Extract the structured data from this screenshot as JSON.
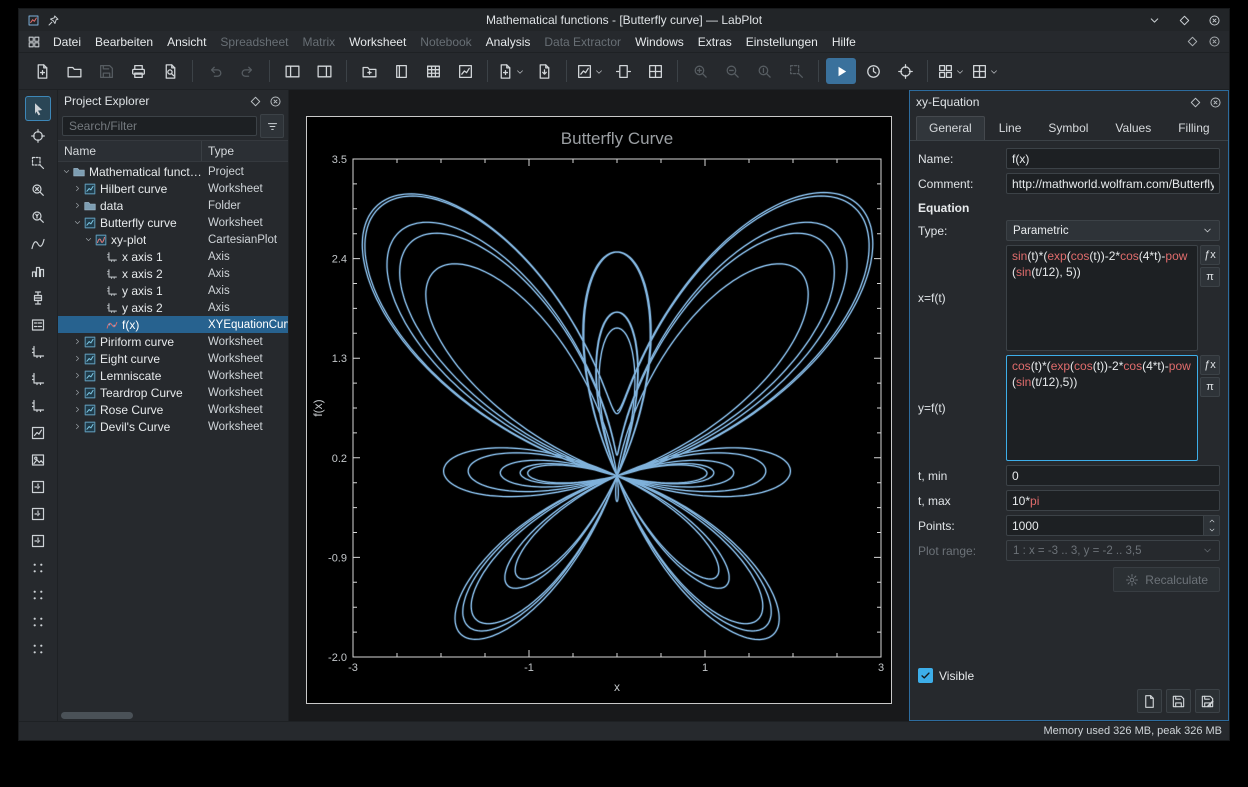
{
  "window": {
    "title": "Mathematical functions - [Butterfly curve] — LabPlot"
  },
  "menubar": {
    "items": [
      {
        "label": "Datei",
        "enabled": true
      },
      {
        "label": "Bearbeiten",
        "enabled": true
      },
      {
        "label": "Ansicht",
        "enabled": true
      },
      {
        "label": "Spreadsheet",
        "enabled": false
      },
      {
        "label": "Matrix",
        "enabled": false
      },
      {
        "label": "Worksheet",
        "enabled": true
      },
      {
        "label": "Notebook",
        "enabled": false
      },
      {
        "label": "Analysis",
        "enabled": true
      },
      {
        "label": "Data Extractor",
        "enabled": false
      },
      {
        "label": "Windows",
        "enabled": true
      },
      {
        "label": "Extras",
        "enabled": true
      },
      {
        "label": "Einstellungen",
        "enabled": true
      },
      {
        "label": "Hilfe",
        "enabled": true
      }
    ]
  },
  "toolbar": {
    "buttons": [
      {
        "name": "new-project",
        "icon": "doc-new"
      },
      {
        "name": "open-project",
        "icon": "folder-open"
      },
      {
        "name": "save-project",
        "icon": "save",
        "disabled": true
      },
      {
        "name": "print",
        "icon": "printer"
      },
      {
        "name": "print-preview",
        "icon": "doc-search"
      },
      {
        "sep": true
      },
      {
        "name": "undo",
        "icon": "undo",
        "disabled": true
      },
      {
        "name": "redo",
        "icon": "redo",
        "disabled": true
      },
      {
        "sep": true
      },
      {
        "name": "toggle-project-explorer",
        "icon": "panel-left"
      },
      {
        "name": "toggle-properties-explorer",
        "icon": "panel-right"
      },
      {
        "sep": true
      },
      {
        "name": "new-folder",
        "icon": "folder-new"
      },
      {
        "name": "new-workbook",
        "icon": "book"
      },
      {
        "name": "new-spreadsheet",
        "icon": "table"
      },
      {
        "name": "new-worksheet",
        "icon": "chart"
      },
      {
        "sep": true
      },
      {
        "name": "add-new",
        "icon": "doc-plus",
        "chevron": true
      },
      {
        "name": "import",
        "icon": "doc-import"
      },
      {
        "sep": true
      },
      {
        "name": "export-worksheet",
        "icon": "chart-box",
        "chevron": true
      },
      {
        "name": "zoom-fit-page",
        "icon": "page-fit"
      },
      {
        "name": "view-mode",
        "icon": "grid2"
      },
      {
        "sep": true
      },
      {
        "name": "zoom-in",
        "icon": "zoom-in",
        "disabled": true
      },
      {
        "name": "zoom-out",
        "icon": "zoom-out",
        "disabled": true
      },
      {
        "name": "zoom-original",
        "icon": "zoom-orig",
        "disabled": true
      },
      {
        "name": "zoom-select",
        "icon": "zoom-select",
        "disabled": true
      },
      {
        "sep": true
      },
      {
        "name": "select-and-edit-mode",
        "icon": "play",
        "active": true
      },
      {
        "name": "navigate-mode",
        "icon": "clock"
      },
      {
        "name": "zoom-select-mode",
        "icon": "crosshair"
      },
      {
        "sep": true
      },
      {
        "name": "cartesian-plot-add",
        "icon": "grid",
        "chevron": true
      },
      {
        "name": "cartesian-plot-mouse-mode",
        "icon": "grid2",
        "chevron": true
      }
    ]
  },
  "left_toolbar": {
    "buttons": [
      {
        "name": "pointer-tool",
        "icon": "cursor",
        "active": true
      },
      {
        "name": "navigation-tool",
        "icon": "crosshair"
      },
      {
        "name": "zoom-select-tool",
        "icon": "zoom-select"
      },
      {
        "name": "zoom-x-select-tool",
        "icon": "zoom-x"
      },
      {
        "name": "zoom-y-select-tool",
        "icon": "zoom-y"
      },
      {
        "name": "add-curve-tool",
        "icon": "curve"
      },
      {
        "name": "add-histogram-tool",
        "icon": "histogram"
      },
      {
        "name": "add-boxplot-tool",
        "icon": "boxplot"
      },
      {
        "name": "add-legend-tool",
        "icon": "legend"
      },
      {
        "name": "add-horizontal-axis-tool",
        "icon": "axis"
      },
      {
        "name": "add-vertical-axis-tool",
        "icon": "axis"
      },
      {
        "name": "add-custom-axis-tool",
        "icon": "axis"
      },
      {
        "name": "add-plot-tool",
        "icon": "chart"
      },
      {
        "name": "add-image-tool",
        "icon": "image"
      },
      {
        "name": "auto-scale-tool",
        "icon": "zoom-fit"
      },
      {
        "name": "auto-scale-x-tool",
        "icon": "zoom-fit"
      },
      {
        "name": "auto-scale-y-tool",
        "icon": "zoom-fit"
      },
      {
        "name": "zoom-in-plot-tool",
        "icon": "dots"
      },
      {
        "name": "zoom-out-plot-tool",
        "icon": "dots"
      },
      {
        "name": "shift-left-x-tool",
        "icon": "dots"
      },
      {
        "name": "shift-up-y-tool",
        "icon": "dots"
      }
    ]
  },
  "project_explorer": {
    "title": "Project Explorer",
    "search_placeholder": "Search/Filter",
    "columns": [
      "Name",
      "Type"
    ],
    "rows": [
      {
        "name": "Mathematical functions",
        "type": "Project",
        "depth": 0,
        "expander": "open",
        "icon": "folder-t"
      },
      {
        "name": "Hilbert curve",
        "type": "Worksheet",
        "depth": 1,
        "expander": "closed",
        "icon": "worksheet-t"
      },
      {
        "name": "data",
        "type": "Folder",
        "depth": 1,
        "expander": "closed",
        "icon": "folder-t"
      },
      {
        "name": "Butterfly curve",
        "type": "Worksheet",
        "depth": 1,
        "expander": "open",
        "icon": "worksheet-t"
      },
      {
        "name": "xy-plot",
        "type": "CartesianPlot",
        "depth": 2,
        "expander": "open",
        "icon": "plot-t"
      },
      {
        "name": "x axis 1",
        "type": "Axis",
        "depth": 3,
        "icon": "axis-t"
      },
      {
        "name": "x axis 2",
        "type": "Axis",
        "depth": 3,
        "icon": "axis-t"
      },
      {
        "name": "y axis 1",
        "type": "Axis",
        "depth": 3,
        "icon": "axis-t"
      },
      {
        "name": "y axis 2",
        "type": "Axis",
        "depth": 3,
        "icon": "axis-t"
      },
      {
        "name": "f(x)",
        "type": "XYEquationCurve",
        "depth": 3,
        "icon": "curve-t",
        "selected": true
      },
      {
        "name": "Piriform curve",
        "type": "Worksheet",
        "depth": 1,
        "expander": "closed",
        "icon": "worksheet-t"
      },
      {
        "name": "Eight curve",
        "type": "Worksheet",
        "depth": 1,
        "expander": "closed",
        "icon": "worksheet-t"
      },
      {
        "name": "Lemniscate",
        "type": "Worksheet",
        "depth": 1,
        "expander": "closed",
        "icon": "worksheet-t"
      },
      {
        "name": "Teardrop Curve",
        "type": "Worksheet",
        "depth": 1,
        "expander": "closed",
        "icon": "worksheet-t"
      },
      {
        "name": "Rose Curve",
        "type": "Worksheet",
        "depth": 1,
        "expander": "closed",
        "icon": "worksheet-t"
      },
      {
        "name": "Devil's Curve",
        "type": "Worksheet",
        "depth": 1,
        "expander": "closed",
        "icon": "worksheet-t"
      }
    ]
  },
  "chart_data": {
    "type": "line",
    "title": "Butterfly Curve",
    "xlabel": "x",
    "ylabel": "f(x)",
    "xlim": [
      -3,
      3
    ],
    "ylim": [
      -2.0,
      3.5
    ],
    "x_major": [
      -3,
      -1,
      1,
      3
    ],
    "x_tick_labels": [
      "-3",
      "-1",
      "1",
      "3"
    ],
    "y_major": [
      3.5,
      2.4,
      1.3,
      0.2,
      -0.9,
      -2.0
    ],
    "y_tick_labels": [
      "3.5",
      "2.4",
      "1.3",
      "0.2",
      "-0.9",
      "-2.0"
    ],
    "equation_x": "sin(t)*(exp(cos(t))-2*cos(4*t)-pow(sin(t/12), 5))",
    "equation_y": "cos(t)*(exp(cos(t))-2*cos(4*t)-pow(sin(t/12),5))",
    "t_min": 0,
    "t_max": "10*pi",
    "points": 1000,
    "curve_color": "#7fb1da",
    "background": "#000000",
    "grid": false,
    "legend": false
  },
  "equation_panel": {
    "title": "xy-Equation",
    "tabs": [
      "General",
      "Line",
      "Symbol",
      "Values",
      "Filling"
    ],
    "active_tab": "General",
    "name_label": "Name:",
    "name_value": "f(x)",
    "comment_label": "Comment:",
    "comment_value": "http://mathworld.wolfram.com/ButterflyCurve.html",
    "equation_section": "Equation",
    "type_label": "Type:",
    "type_value": "Parametric",
    "x_label": "x=f(t)",
    "x_value": "sin(t)*(exp(cos(t))-2*cos(4*t)-pow(sin(t/12), 5))",
    "y_label": "y=f(t)",
    "y_value": "cos(t)*(exp(cos(t))-2*cos(4*t)-pow(sin(t/12),5))",
    "tmin_label": "t, min",
    "tmin_value": "0",
    "tmax_label": "t, max",
    "tmax_value": "10*pi",
    "points_label": "Points:",
    "points_value": "1000",
    "plot_range_label": "Plot range:",
    "plot_range_value": "1 : x = -3 .. 3, y = -2 .. 3,5",
    "recalculate_label": "Recalculate",
    "visible_label": "Visible",
    "insert_function_label": "ƒx",
    "insert_constant_label": "π"
  },
  "statusbar": {
    "memory": "Memory used 326 MB, peak 326 MB"
  }
}
